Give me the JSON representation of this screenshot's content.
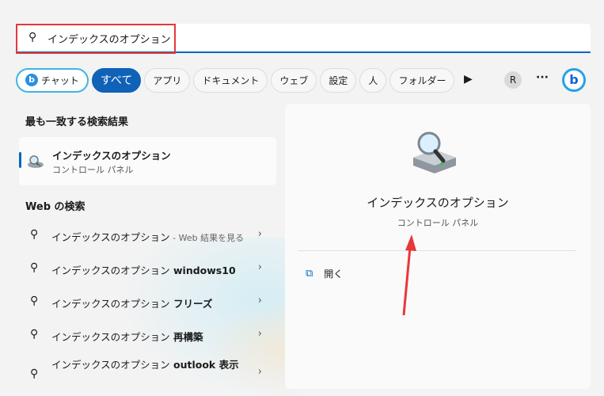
{
  "search": {
    "icon": "search-icon",
    "value": "インデックスのオプション"
  },
  "filters": [
    {
      "label": "チャット"
    },
    {
      "label": "すべて"
    },
    {
      "label": "アプリ"
    },
    {
      "label": "ドキュメント"
    },
    {
      "label": "ウェブ"
    },
    {
      "label": "設定"
    },
    {
      "label": "人"
    },
    {
      "label": "フォルダー"
    }
  ],
  "avatar_letter": "R",
  "best_match": {
    "heading": "最も一致する検索結果",
    "title": "インデックスのオプション",
    "subtitle": "コントロール パネル"
  },
  "web": {
    "heading": "Web の検索",
    "items": [
      {
        "main": "インデックスのオプション",
        "suffix": " - Web 結果を見る",
        "suffix_style": "sub"
      },
      {
        "main": "インデックスのオプション",
        "suffix": " windows10"
      },
      {
        "main": "インデックスのオプション",
        "suffix": " フリーズ"
      },
      {
        "main": "インデックスのオプション",
        "suffix": " 再構築"
      },
      {
        "main": "インデックスのオプション",
        "suffix": " outlook 表示"
      }
    ]
  },
  "detail": {
    "title": "インデックスのオプション",
    "subtitle": "コントロール パネル",
    "open_label": "開く"
  },
  "colors": {
    "accent": "#0067c0",
    "highlight": "#e8373a"
  }
}
